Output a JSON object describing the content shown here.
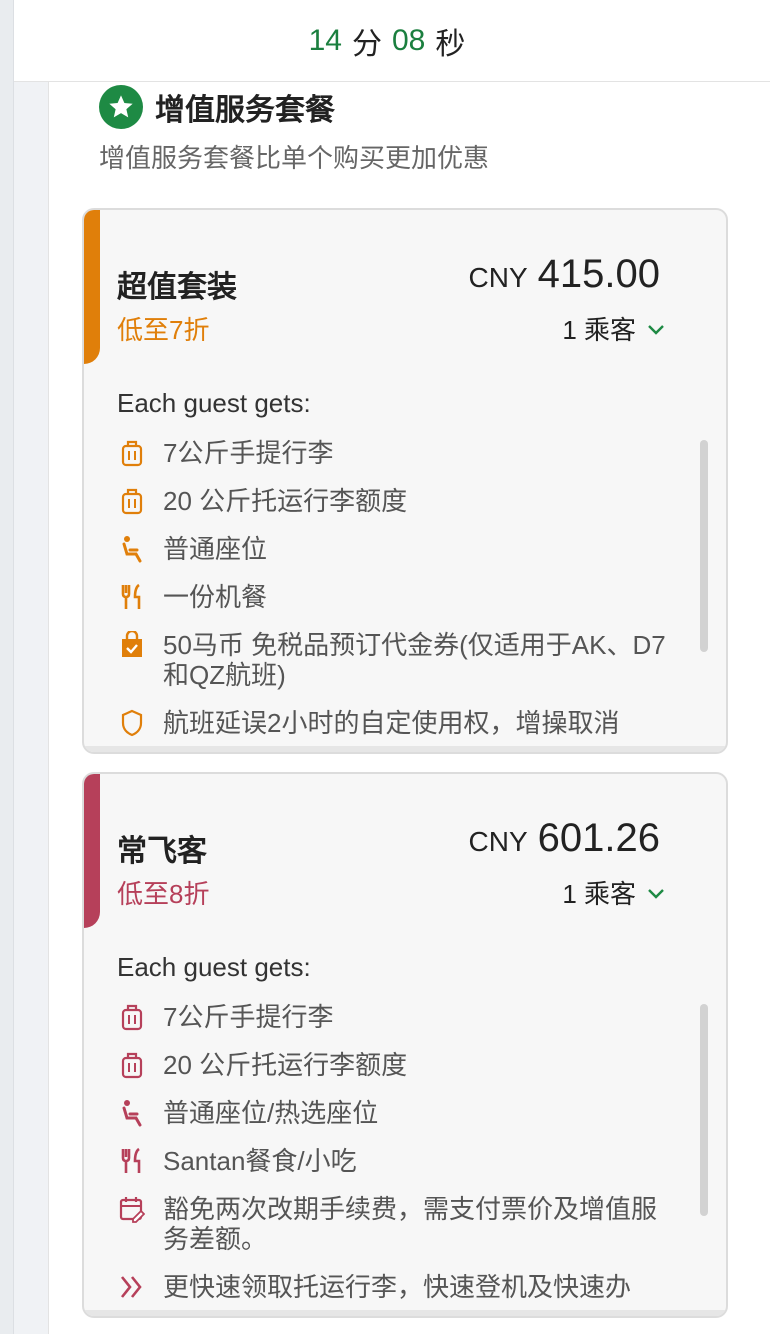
{
  "timer": {
    "minutes": "14",
    "min_unit": "分",
    "seconds": "08",
    "sec_unit": "秒"
  },
  "section": {
    "title": "增值服务套餐",
    "subtitle": "增值服务套餐比单个购买更加优惠"
  },
  "colors": {
    "green": "#1e8a44",
    "orange": "#e07f0a",
    "crimson": "#b6405a"
  },
  "cards": [
    {
      "title": "超值套装",
      "discount": "低至7折",
      "currency": "CNY",
      "price": "415.00",
      "passengers": "1 乘客",
      "each_label": "Each guest gets:",
      "benefits": [
        {
          "icon": "luggage-icon",
          "text": "7公斤手提行李"
        },
        {
          "icon": "luggage-icon",
          "text": "20 公斤托运行李额度"
        },
        {
          "icon": "seat-icon",
          "text": "普通座位"
        },
        {
          "icon": "meal-icon",
          "text": "一份机餐"
        },
        {
          "icon": "shopping-bag-icon",
          "text": "50马币 免税品预订代金券(仅适用于AK、D7和QZ航班)"
        },
        {
          "icon": "shield-icon",
          "text": "航班延误2小时的自定使用权，增操取消"
        }
      ]
    },
    {
      "title": "常飞客",
      "discount": "低至8折",
      "currency": "CNY",
      "price": "601.26",
      "passengers": "1 乘客",
      "each_label": "Each guest gets:",
      "benefits": [
        {
          "icon": "luggage-icon",
          "text": "7公斤手提行李"
        },
        {
          "icon": "luggage-icon",
          "text": "20 公斤托运行李额度"
        },
        {
          "icon": "seat-icon",
          "text": "普通座位/热选座位"
        },
        {
          "icon": "meal-icon",
          "text": "Santan餐食/小吃"
        },
        {
          "icon": "calendar-edit-icon",
          "text": "豁免两次改期手续费，需支付票价及增值服务差额。"
        },
        {
          "icon": "fast-track-icon",
          "text": "更快速领取托运行李，快速登机及快速办"
        }
      ]
    }
  ]
}
